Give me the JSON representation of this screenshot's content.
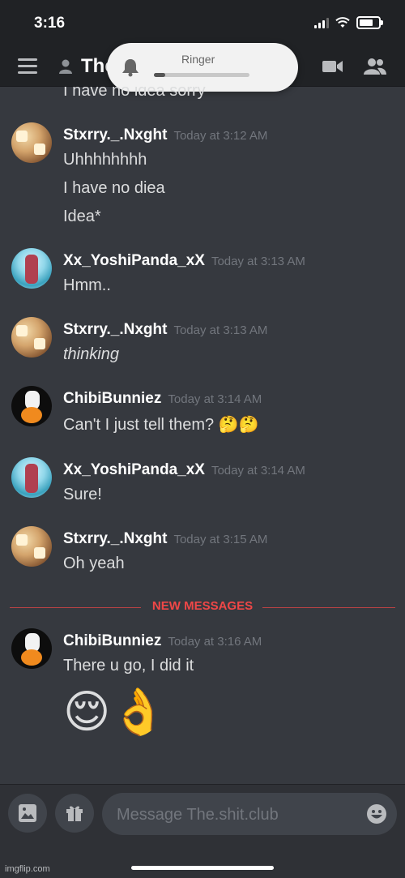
{
  "status_bar": {
    "time": "3:16"
  },
  "header": {
    "channel_name": "The.shit.club"
  },
  "ringer": {
    "label": "Ringer",
    "level": 0.12
  },
  "messages": [
    {
      "type": "continuation",
      "lines": [
        "I have no idea sorry"
      ]
    },
    {
      "author": "Stxrry._.Nxght",
      "timestamp": "Today at 3:12 AM",
      "avatar": "stxrry-avatar",
      "lines": [
        "Uhhhhhhhh",
        "I have no diea",
        "Idea*"
      ]
    },
    {
      "author": "Xx_YoshiPanda_xX",
      "timestamp": "Today at 3:13 AM",
      "avatar": "yoshipanda-avatar",
      "lines": [
        "Hmm.."
      ]
    },
    {
      "author": "Stxrry._.Nxght",
      "timestamp": "Today at 3:13 AM",
      "avatar": "stxrry-avatar",
      "lines": [
        "thinking"
      ]
    },
    {
      "author": "ChibiBunniez",
      "timestamp": "Today at 3:14 AM",
      "avatar": "chibibunniez-avatar",
      "lines": [
        "Can't I just tell them? 🤔🤔"
      ]
    },
    {
      "author": "Xx_YoshiPanda_xX",
      "timestamp": "Today at 3:14 AM",
      "avatar": "yoshipanda-avatar",
      "lines": [
        "Sure!"
      ]
    },
    {
      "author": "Stxrry._.Nxght",
      "timestamp": "Today at 3:15 AM",
      "avatar": "stxrry-avatar",
      "lines": [
        "Oh yeah"
      ]
    },
    {
      "author": "ChibiBunniez",
      "timestamp": "Today at 3:16 AM",
      "avatar": "chibibunniez-avatar",
      "lines": [
        "There u go, I did it"
      ],
      "big_emoji": "😌👌"
    }
  ],
  "divider": {
    "label": "NEW MESSAGES"
  },
  "composer": {
    "placeholder": "Message The.shit.club"
  },
  "watermark": "imgflip.com",
  "colors": {
    "background": "#36393f",
    "header": "#202225",
    "new_messages": "#f04747",
    "timestamp": "#72767d"
  }
}
